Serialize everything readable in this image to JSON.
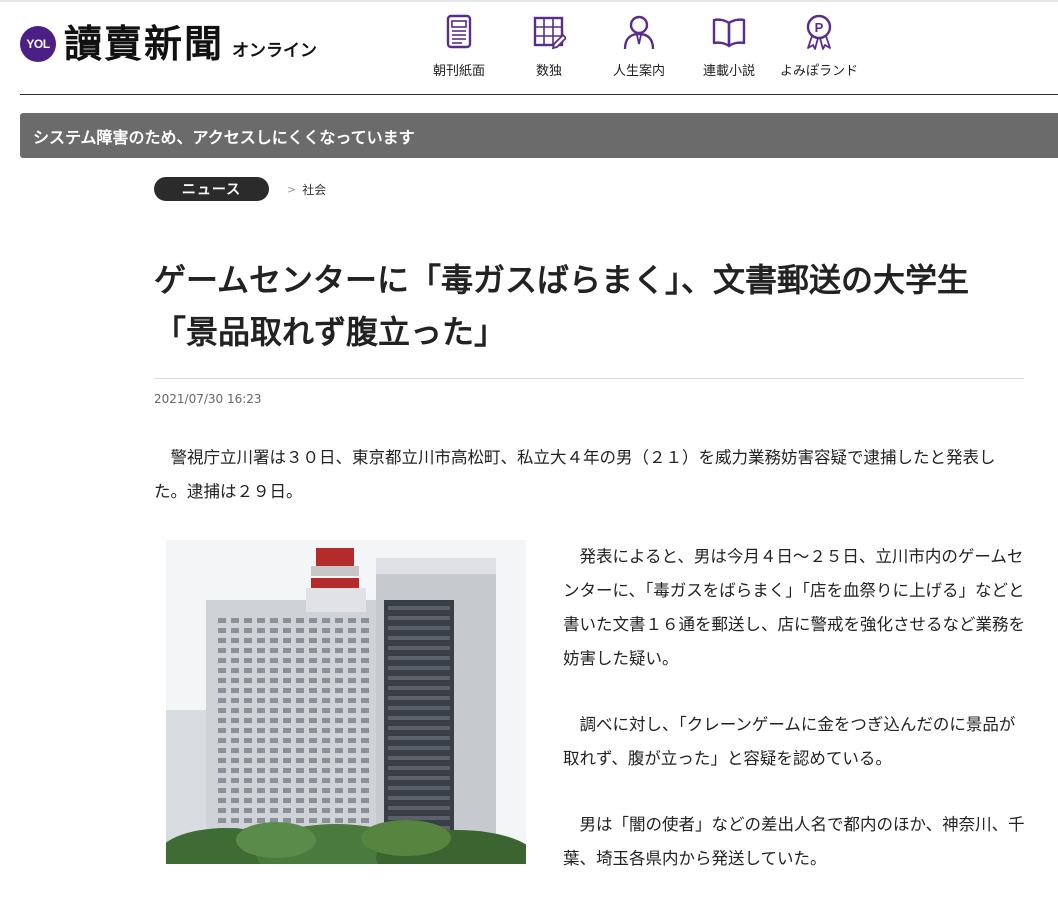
{
  "header": {
    "logo_badge": "YOL",
    "brand": "讀賣新聞",
    "brand_sub": "オンライン",
    "nav": [
      {
        "label": "朝刊紙面",
        "icon": "newspaper-icon"
      },
      {
        "label": "数独",
        "icon": "sudoku-grid-icon"
      },
      {
        "label": "人生案内",
        "icon": "person-advice-icon"
      },
      {
        "label": "連載小説",
        "icon": "open-book-icon"
      },
      {
        "label": "よみぽランド",
        "icon": "points-coin-icon"
      }
    ]
  },
  "alert": {
    "text": "システム障害のため、アクセスしにくくなっています"
  },
  "breadcrumb": {
    "category": "ニュース",
    "separator": ">",
    "subcategory": "社会"
  },
  "article": {
    "title": "ゲームセンターに「毒ガスばらまく」、文書郵送の大学生「景品取れず腹立った」",
    "date": "2021/07/30 16:23",
    "lead": "警視庁立川署は３０日、東京都立川市高松町、私立大４年の男（２１）を威力業務妨害容疑で逮捕したと発表した。逮捕は２９日。",
    "paragraphs": [
      "発表によると、男は今月４日～２５日、立川市内のゲームセンターに、「毒ガスをばらまく」「店を血祭りに上げる」などと書いた文書１６通を郵送し、店に警戒を強化させるなど業務を妨害した疑い。",
      "調べに対し、「クレーンゲームに金をつぎ込んだのに景品が取れず、腹が立った」と容疑を認めている。",
      "男は「闇の使者」などの差出人名で都内のほか、神奈川、千葉、埼玉各県内から発送していた。"
    ]
  },
  "colors": {
    "accent": "#5a2d8c",
    "alert_bg": "#6b6b6b",
    "pill_bg": "#2b2b2b"
  }
}
